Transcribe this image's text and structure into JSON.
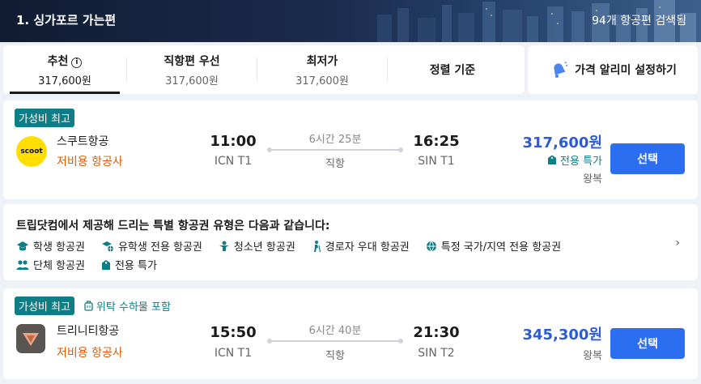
{
  "header": {
    "title": "1. 싱가포르 가는편",
    "result_count": "94개 항공편 검색됨"
  },
  "sort_tabs": [
    {
      "label": "추천",
      "price": "317,600원",
      "active": true
    },
    {
      "label": "직항편 우선",
      "price": "317,600원"
    },
    {
      "label": "최저가",
      "price": "317,600원"
    },
    {
      "label": "정렬 기준"
    }
  ],
  "price_alert": {
    "label": "가격 알리미 설정하기",
    "icon": "bell-icon"
  },
  "flights": [
    {
      "badge": "가성비 최고",
      "airline": "스쿠트항공",
      "airline_type": "저비용 항공사",
      "logo_text": "scoot",
      "depart_time": "11:00",
      "depart_airport": "ICN T1",
      "duration": "6시간 25분",
      "stops": "직항",
      "arrive_time": "16:25",
      "arrive_airport": "SIN T1",
      "price": "317,600원",
      "deal": "전용 특가",
      "trip_type": "왕복",
      "select_label": "선택"
    },
    {
      "badge": "가성비 최고",
      "extra_badge": "위탁 수하물 포함",
      "airline": "트리니티항공",
      "airline_type": "저비용 항공사",
      "depart_time": "15:50",
      "depart_airport": "ICN T1",
      "duration": "6시간 40분",
      "stops": "직항",
      "arrive_time": "21:30",
      "arrive_airport": "SIN T2",
      "price": "345,300원",
      "trip_type": "왕복",
      "select_label": "선택"
    }
  ],
  "special_fares": {
    "heading": "트립닷컴에서 제공해 드리는 특별 항공권 유형은 다음과 같습니다:",
    "items": [
      {
        "label": "학생 항공권",
        "icon": "graduation-cap-icon"
      },
      {
        "label": "유학생 전용 항공권",
        "icon": "student-abroad-icon"
      },
      {
        "label": "청소년 항공권",
        "icon": "youth-icon"
      },
      {
        "label": "경로자 우대 항공권",
        "icon": "senior-icon"
      },
      {
        "label": "특정 국가/지역 전용 항공권",
        "icon": "globe-icon"
      },
      {
        "label": "단체 항공권",
        "icon": "group-icon"
      },
      {
        "label": "전용 특가",
        "icon": "tag-icon"
      }
    ]
  },
  "colors": {
    "accent": "#2b6ef0",
    "price": "#2b5bd6",
    "badge": "#0d7e86",
    "low_cost": "#e05a00"
  }
}
